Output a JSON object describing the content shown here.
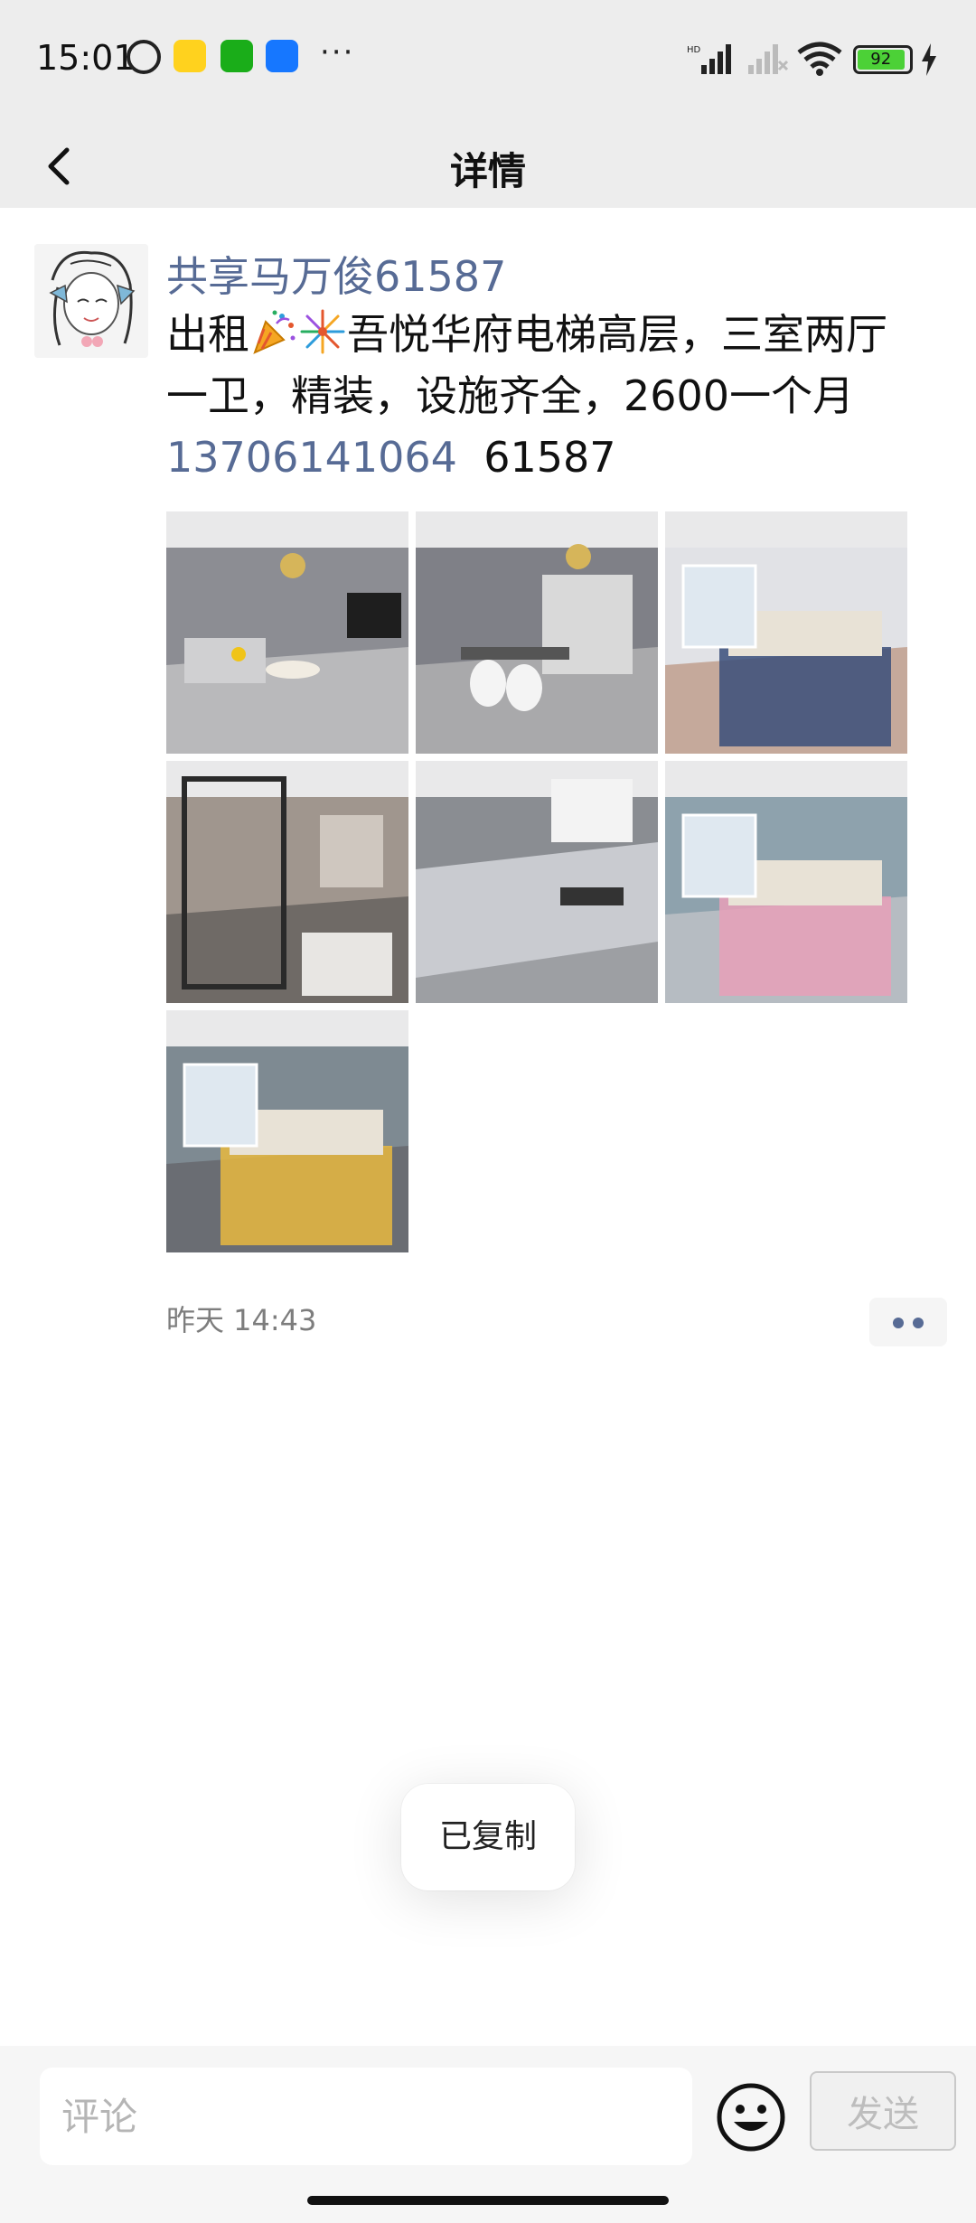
{
  "status_bar": {
    "time": "15:01",
    "battery": "92",
    "battery_level_percent": 92,
    "notification_icons": [
      "alarm-icon",
      "meituan-icon",
      "wechat-icon",
      "blue-app-icon"
    ],
    "more_dots": "···"
  },
  "header": {
    "title": "详情",
    "back_icon": "chevron-left-icon"
  },
  "post": {
    "author": "共享马万俊61587",
    "text_part1": "出租",
    "text_part2": "吾悦华府电梯高层，三室两厅一卫，精装，设施齐全，2600一个月",
    "phone": "13706141064",
    "suffix": "61587",
    "timestamp": "昨天 14:43",
    "photos": [
      {
        "subject": "living-room",
        "colors": {
          "wall": "#8c8d93",
          "floor": "#b9b9bb",
          "accent": "#f0c419"
        }
      },
      {
        "subject": "dining-room",
        "colors": {
          "wall": "#7f8087",
          "floor": "#a9a9ab",
          "accent": "#d9d9d9"
        }
      },
      {
        "subject": "bedroom-window",
        "colors": {
          "wall": "#e1e2e6",
          "floor": "#c5a99b",
          "accent": "#3a4f7a"
        }
      },
      {
        "subject": "bathroom",
        "colors": {
          "wall": "#a0968e",
          "floor": "#6f6a66",
          "accent": "#2a2a2a"
        }
      },
      {
        "subject": "kitchen",
        "colors": {
          "wall": "#8a8d92",
          "floor": "#9d9fa3",
          "accent": "#c9cbd0"
        }
      },
      {
        "subject": "bedroom-wardrobe",
        "colors": {
          "wall": "#8ea2ad",
          "floor": "#b6bcc2",
          "accent": "#e7a0b8"
        }
      },
      {
        "subject": "bedroom-balcony",
        "colors": {
          "wall": "#7e8a92",
          "floor": "#6a6d73",
          "accent": "#e8b940"
        }
      }
    ]
  },
  "toast": {
    "text": "已复制"
  },
  "bottom_bar": {
    "comment_placeholder": "评论",
    "send_label": "发送",
    "emoji_icon": "smiley-icon"
  },
  "colors": {
    "link": "#576b95",
    "header_bg": "#ededed",
    "timestamp": "#7d7d7d"
  }
}
